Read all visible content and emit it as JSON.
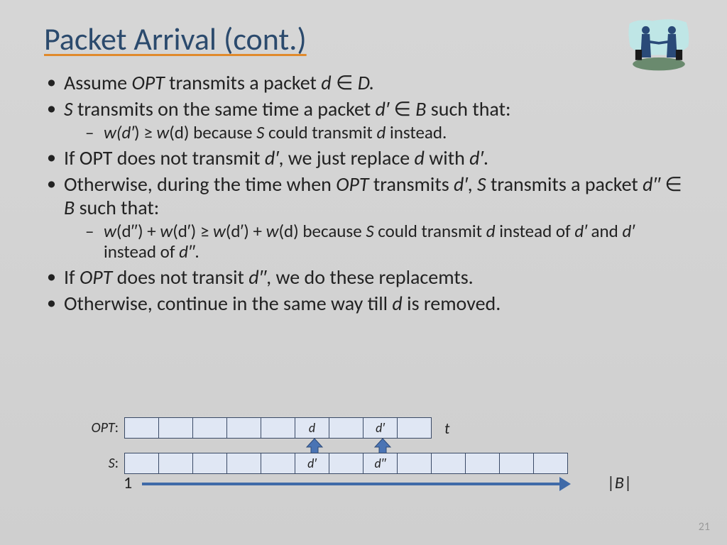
{
  "title": "Packet Arrival (cont.)",
  "bullets": {
    "b1_pre": "Assume ",
    "b1_mid": "OPT",
    "b1_post1": " transmits a packet ",
    "b1_d": "d",
    "b1_in": " ∈ ",
    "b1_D": "D.",
    "b2_S": "S",
    "b2_mid": " transmits on the same time a packet ",
    "b2_dp": "d′ ",
    "b2_in": "∈ ",
    "b2_B": "B",
    "b2_post": " such that:",
    "b2s_pre": "w(d′",
    "b2s_ge": ") ≥ ",
    "b2s_wd": "w",
    "b2s_d": "(d) because ",
    "b2s_S": "S",
    "b2s_mid": " could transmit ",
    "b2s_d2": "d",
    "b2s_post": " instead.",
    "b3_pre": "If OPT does not transmit ",
    "b3_dp": "d′",
    "b3_mid": ", we just replace ",
    "b3_d": "d",
    "b3_with": " with ",
    "b3_dp2": "d′",
    "b3_post": ".",
    "b4_pre": "Otherwise, during the time when ",
    "b4_OPT": "OPT",
    "b4_mid": " transmits ",
    "b4_dp": "d′",
    "b4_comma": ", ",
    "b4_S": "S",
    "b4_mid2": " transmits a packet ",
    "b4_dpp": "d′′ ",
    "b4_in": "∈ ",
    "b4_B": "B",
    "b4_post": " such that:",
    "b4s_pre": "w",
    "b4s_a": "(d′′",
    "b4s_plus1": ") + ",
    "b4s_w2": "w",
    "b4s_b": "(d′",
    "b4s_ge": ") ≥ ",
    "b4s_w3": "w",
    "b4s_c": "(d′) + ",
    "b4s_w4": "w",
    "b4s_d": "(d",
    "b4s_mid": ") because ",
    "b4s_S": "S",
    "b4s_mid2": " could transmit ",
    "b4s_d2": "d",
    "b4s_mid3": " instead of ",
    "b4s_dp": "d′",
    "b4s_and": " and ",
    "b4s_dp2": "d′",
    "b4s_mid4": " instead of ",
    "b4s_dpp": "d′′",
    "b4s_post": ".",
    "b5_pre": "If ",
    "b5_OPT": "OPT",
    "b5_mid": " does not transit ",
    "b5_dpp": "d′′",
    "b5_post": ", we do these replacemts.",
    "b6_pre": "Otherwise, continue in the same way till ",
    "b6_d": "d",
    "b6_post": " is removed."
  },
  "diagram": {
    "row1_label": "OPT",
    "row1_colon": ":",
    "row2_label": "S",
    "row2_colon": ":",
    "opt_d": "d",
    "opt_dp": "d′",
    "s_dp": "d′",
    "s_dpp": "d′′",
    "t": "t",
    "axis_start": "1",
    "axis_end": "|B|"
  },
  "page_number": "21"
}
